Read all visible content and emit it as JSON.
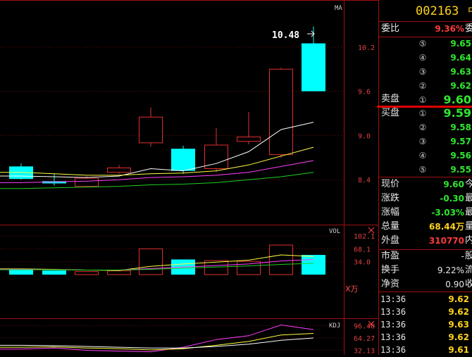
{
  "colors": {
    "up": "#e03030",
    "down": "#00ffff",
    "grid": "#7a1010",
    "ma_white": "#ffffff",
    "ma_yellow": "#ffff40",
    "ma_magenta": "#ff40ff",
    "ma_green": "#20d020",
    "price_green": "#2ee82e",
    "price_red": "#ff3b3b",
    "price_yellow": "#ffd21e"
  },
  "chart_data": [
    {
      "type": "candlestick",
      "indicator_label": "MA",
      "high_annotation": "10.48",
      "y_ticks": [
        "10.2",
        "9.6",
        "9.0",
        "8.4"
      ],
      "ylim": [
        7.8,
        10.8
      ],
      "candles": [
        {
          "open": 8.58,
          "close": 8.41,
          "high": 8.62,
          "low": 8.4
        },
        {
          "open": 8.38,
          "close": 8.35,
          "high": 8.48,
          "low": 8.32
        },
        {
          "open": 8.31,
          "close": 8.42,
          "high": 8.45,
          "low": 8.3
        },
        {
          "open": 8.5,
          "close": 8.56,
          "high": 8.6,
          "low": 8.48
        },
        {
          "open": 8.9,
          "close": 9.25,
          "high": 9.38,
          "low": 8.85
        },
        {
          "open": 8.82,
          "close": 8.52,
          "high": 8.86,
          "low": 8.48
        },
        {
          "open": 8.55,
          "close": 8.87,
          "high": 9.1,
          "low": 8.5
        },
        {
          "open": 8.92,
          "close": 8.98,
          "high": 9.32,
          "low": 8.88
        },
        {
          "open": 8.74,
          "close": 9.9,
          "high": 9.92,
          "low": 8.7
        },
        {
          "open": 10.25,
          "close": 9.6,
          "high": 10.48,
          "low": 9.6
        }
      ],
      "ma_series": [
        {
          "color": "#ffffff",
          "values": [
            8.45,
            8.44,
            8.43,
            8.45,
            8.55,
            8.52,
            8.62,
            8.78,
            9.08,
            9.18
          ]
        },
        {
          "color": "#ffff40",
          "values": [
            8.5,
            8.48,
            8.46,
            8.46,
            8.48,
            8.49,
            8.52,
            8.6,
            8.72,
            8.84
          ]
        },
        {
          "color": "#ff40ff",
          "values": [
            8.36,
            8.37,
            8.38,
            8.4,
            8.43,
            8.44,
            8.46,
            8.5,
            8.58,
            8.66
          ]
        },
        {
          "color": "#20d020",
          "values": [
            8.28,
            8.29,
            8.3,
            8.31,
            8.33,
            8.34,
            8.36,
            8.4,
            8.44,
            8.5
          ]
        }
      ]
    },
    {
      "type": "bar",
      "indicator_label": "VOL",
      "unit_label": "X万",
      "y_ticks": [
        "102.1",
        "68.1",
        "34.0"
      ],
      "ylim": [
        0,
        120
      ],
      "values": [
        14,
        11,
        8,
        10,
        68,
        40,
        37,
        35,
        78,
        52
      ],
      "directions": [
        "down",
        "down",
        "up",
        "up",
        "up",
        "down",
        "up",
        "up",
        "up",
        "down"
      ],
      "ma_series": [
        {
          "color": "#ffff40",
          "values": [
            15,
            14,
            12,
            11,
            22,
            28,
            33,
            38,
            52,
            48
          ]
        },
        {
          "color": "#ff40ff",
          "values": [
            14,
            13,
            12,
            12,
            16,
            20,
            24,
            28,
            36,
            40
          ]
        },
        {
          "color": "#20d020",
          "values": [
            13,
            13,
            12,
            12,
            14,
            17,
            20,
            23,
            27,
            30
          ]
        }
      ]
    },
    {
      "type": "line",
      "indicator_label": "KDJ",
      "y_ticks": [
        "96.40",
        "64.27",
        "32.13"
      ],
      "ylim": [
        20,
        110
      ],
      "series": [
        {
          "color": "#ff40ff",
          "values": [
            35,
            38,
            32,
            30,
            28,
            40,
            60,
            70,
            98,
            86
          ]
        },
        {
          "color": "#ffff40",
          "values": [
            40,
            41,
            38,
            36,
            33,
            36,
            45,
            55,
            72,
            76
          ]
        },
        {
          "color": "#ffffff",
          "values": [
            45,
            44,
            42,
            40,
            38,
            38,
            42,
            48,
            58,
            64
          ]
        }
      ]
    }
  ],
  "panel": {
    "code": "002163",
    "code_cut": "中",
    "weibi": {
      "label": "委比",
      "value": "9.36%",
      "cut": "委"
    },
    "sell_label": "卖盘",
    "buy_label": "买盘",
    "sell_orders": [
      {
        "num": "⑤",
        "price": "9.65"
      },
      {
        "num": "④",
        "price": "9.64"
      },
      {
        "num": "③",
        "price": "9.63"
      },
      {
        "num": "②",
        "price": "9.62"
      },
      {
        "num": "①",
        "price": "9.60"
      }
    ],
    "buy_orders": [
      {
        "num": "①",
        "price": "9.59"
      },
      {
        "num": "②",
        "price": "9.58"
      },
      {
        "num": "③",
        "price": "9.57"
      },
      {
        "num": "④",
        "price": "9.56"
      },
      {
        "num": "⑤",
        "price": "9.55"
      }
    ],
    "stats": [
      {
        "label": "现价",
        "value": "9.60",
        "cut": "今",
        "color": "green"
      },
      {
        "label": "涨跌",
        "value": "-0.30",
        "cut": "最",
        "color": "green"
      },
      {
        "label": "涨幅",
        "value": "-3.03%",
        "cut": "最",
        "color": "green"
      },
      {
        "label": "总量",
        "value": "68.44万",
        "cut": "量",
        "color": "yellow"
      },
      {
        "label": "外盘",
        "value": "310770",
        "cut": "内",
        "color": "red"
      }
    ],
    "stats2": [
      {
        "label": "市盈",
        "value": "-",
        "cut": "股",
        "color": "white"
      },
      {
        "label": "换手",
        "value": "9.22%",
        "cut": "流",
        "color": "white"
      },
      {
        "label": "净资",
        "value": "0.90",
        "cut": "收",
        "color": "white"
      }
    ],
    "ticks": [
      {
        "time": "13:36",
        "price": "9.62"
      },
      {
        "time": "13:36",
        "price": "9.62"
      },
      {
        "time": "13:36",
        "price": "9.63"
      },
      {
        "time": "13:36",
        "price": "9.62"
      },
      {
        "time": "13:36",
        "price": "9.61"
      }
    ]
  }
}
